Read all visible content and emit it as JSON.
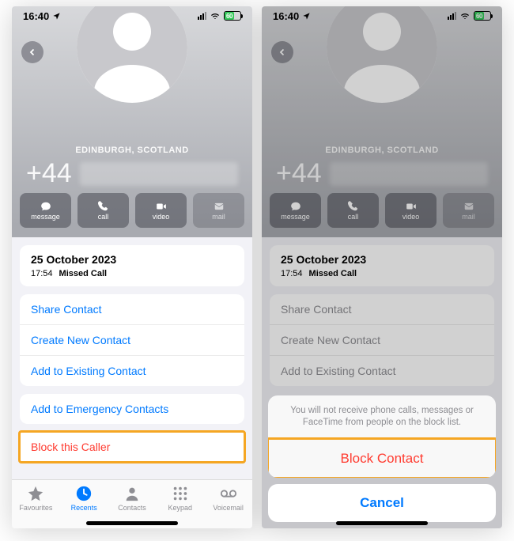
{
  "status": {
    "time": "16:40",
    "battery": "60"
  },
  "contact": {
    "location": "EDINBURGH, SCOTLAND",
    "countryCode": "+44"
  },
  "heroActions": {
    "message": "message",
    "call": "call",
    "video": "video",
    "mail": "mail"
  },
  "callLog": {
    "date": "25 October 2023",
    "time": "17:54",
    "type": "Missed Call"
  },
  "options": {
    "share": "Share Contact",
    "create": "Create New Contact",
    "addExisting": "Add to Existing Contact",
    "addEmergency": "Add to Emergency Contacts",
    "block": "Block this Caller"
  },
  "tabs": {
    "favourites": "Favourites",
    "recents": "Recents",
    "contacts": "Contacts",
    "keypad": "Keypad",
    "voicemail": "Voicemail"
  },
  "actionSheet": {
    "message": "You will not receive phone calls, messages or FaceTime from people on the block list.",
    "block": "Block Contact",
    "cancel": "Cancel"
  }
}
